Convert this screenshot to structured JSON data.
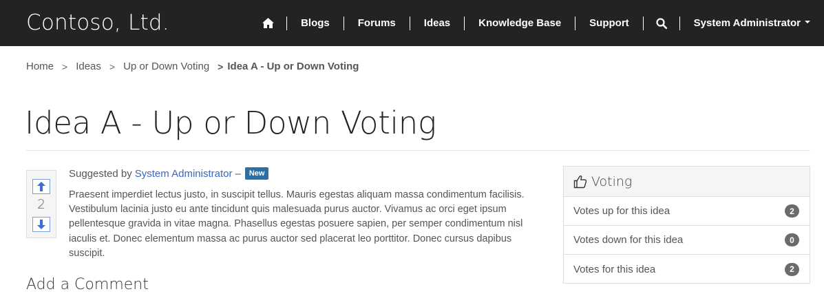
{
  "brand": "Contoso, Ltd.",
  "nav": {
    "home_icon": "home-icon",
    "items": [
      {
        "label": "Blogs"
      },
      {
        "label": "Forums"
      },
      {
        "label": "Ideas"
      },
      {
        "label": "Knowledge Base"
      },
      {
        "label": "Support"
      }
    ],
    "search_icon": "search-icon",
    "user": "System Administrator"
  },
  "breadcrumb": {
    "items": [
      "Home",
      "Ideas",
      "Up or Down Voting"
    ],
    "separator": ">",
    "current": "Idea A - Up or Down Voting"
  },
  "page_title": "Idea A - Up or Down Voting",
  "idea": {
    "vote_count": "2",
    "up_icon": "arrow-up-icon",
    "down_icon": "arrow-down-icon",
    "suggested_prefix": "Suggested by",
    "author": "System Administrator",
    "dash": "–",
    "badge": "New",
    "description": "Praesent imperdiet lectus justo, in suscipit tellus. Mauris egestas aliquam massa condimentum facilisis. Vestibulum lacinia justo eu ante tincidunt quis malesuada purus auctor. Vivamus ac orci eget ipsum pellentesque gravida in vitae magna. Phasellus egestas posuere sapien, per semper condimentum nisl iaculis et. Donec elementum massa ac purus auctor sed placerat leo porttitor. Donec cursus dapibus suscipit."
  },
  "comments_heading": "Add a Comment",
  "voting_panel": {
    "icon": "thumbs-up-icon",
    "title": "Voting",
    "rows": [
      {
        "label": "Votes up for this idea",
        "count": "2"
      },
      {
        "label": "Votes down for this idea",
        "count": "0"
      },
      {
        "label": "Votes for this idea",
        "count": "2"
      }
    ]
  },
  "colors": {
    "navbar": "#232323",
    "link": "#3a66c4",
    "badge_new": "#2f6ea1",
    "count_badge": "#6b6b6b"
  }
}
